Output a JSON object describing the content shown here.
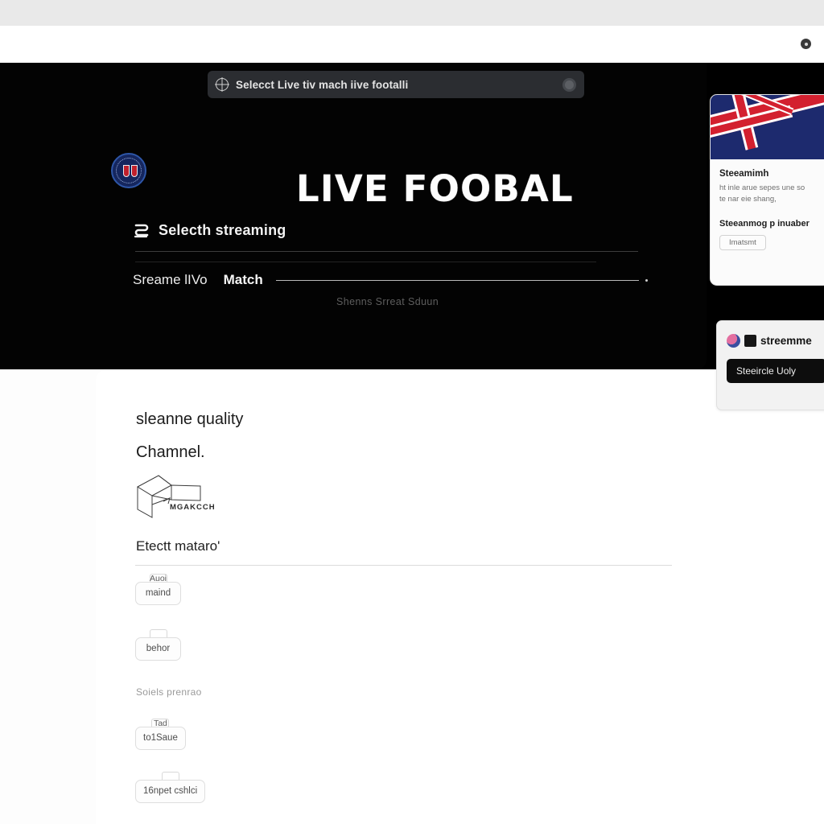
{
  "browser": {
    "toolbar_icon": "circle-indicator-icon"
  },
  "search": {
    "icon": "globe-icon",
    "text": "Selecct Live tiv mach iive footalli",
    "button_icon": "record-button-icon"
  },
  "hero": {
    "logo_icon": "football-crest-icon",
    "title": "LIVE FOOBAL",
    "select_icon": "stream-icon",
    "select_label": "Selecth streaming",
    "match_row": {
      "left": "Sreame lIVo",
      "mid": "Match",
      "end_dot": "end-dot-icon"
    },
    "sub_note": "Shenns  Srreat  Sduun"
  },
  "side_card_1": {
    "flag_icon": "union-jack-flag",
    "title": "Steeamimh",
    "body_line_1": "ht inle arue sepes une so",
    "body_line_2": "te nar eie shang,",
    "title_2": "Steeanmog p inuaber",
    "button_label": "Imatsmt"
  },
  "side_card_2": {
    "avatar_icon": "user-avatar-icon",
    "badge_icon": "square-badge-icon",
    "name": "streemme",
    "bar_label": "Steeircle Uoly"
  },
  "content": {
    "heading_1": "sleanne quality",
    "heading_2": "Chamnel.",
    "sketch_icon": "diagram-sketch-icon",
    "sketch_label": "MGAKCCH",
    "section_label": "Etectt mataro'",
    "note": "Soiels prenrao",
    "chips": [
      {
        "top": "Auoi",
        "label": "maind"
      },
      {
        "top": "",
        "label": "behor"
      },
      {
        "top": "Tad",
        "label": "to1Saue"
      },
      {
        "top": "",
        "label": "16npet cshlci"
      }
    ]
  },
  "colors": {
    "hero_bg": "#000000",
    "flag_navy": "#1d2a6e",
    "flag_red": "#d3202f",
    "card_bg": "#ffffff",
    "dark_bar": "#0d0d0d"
  }
}
